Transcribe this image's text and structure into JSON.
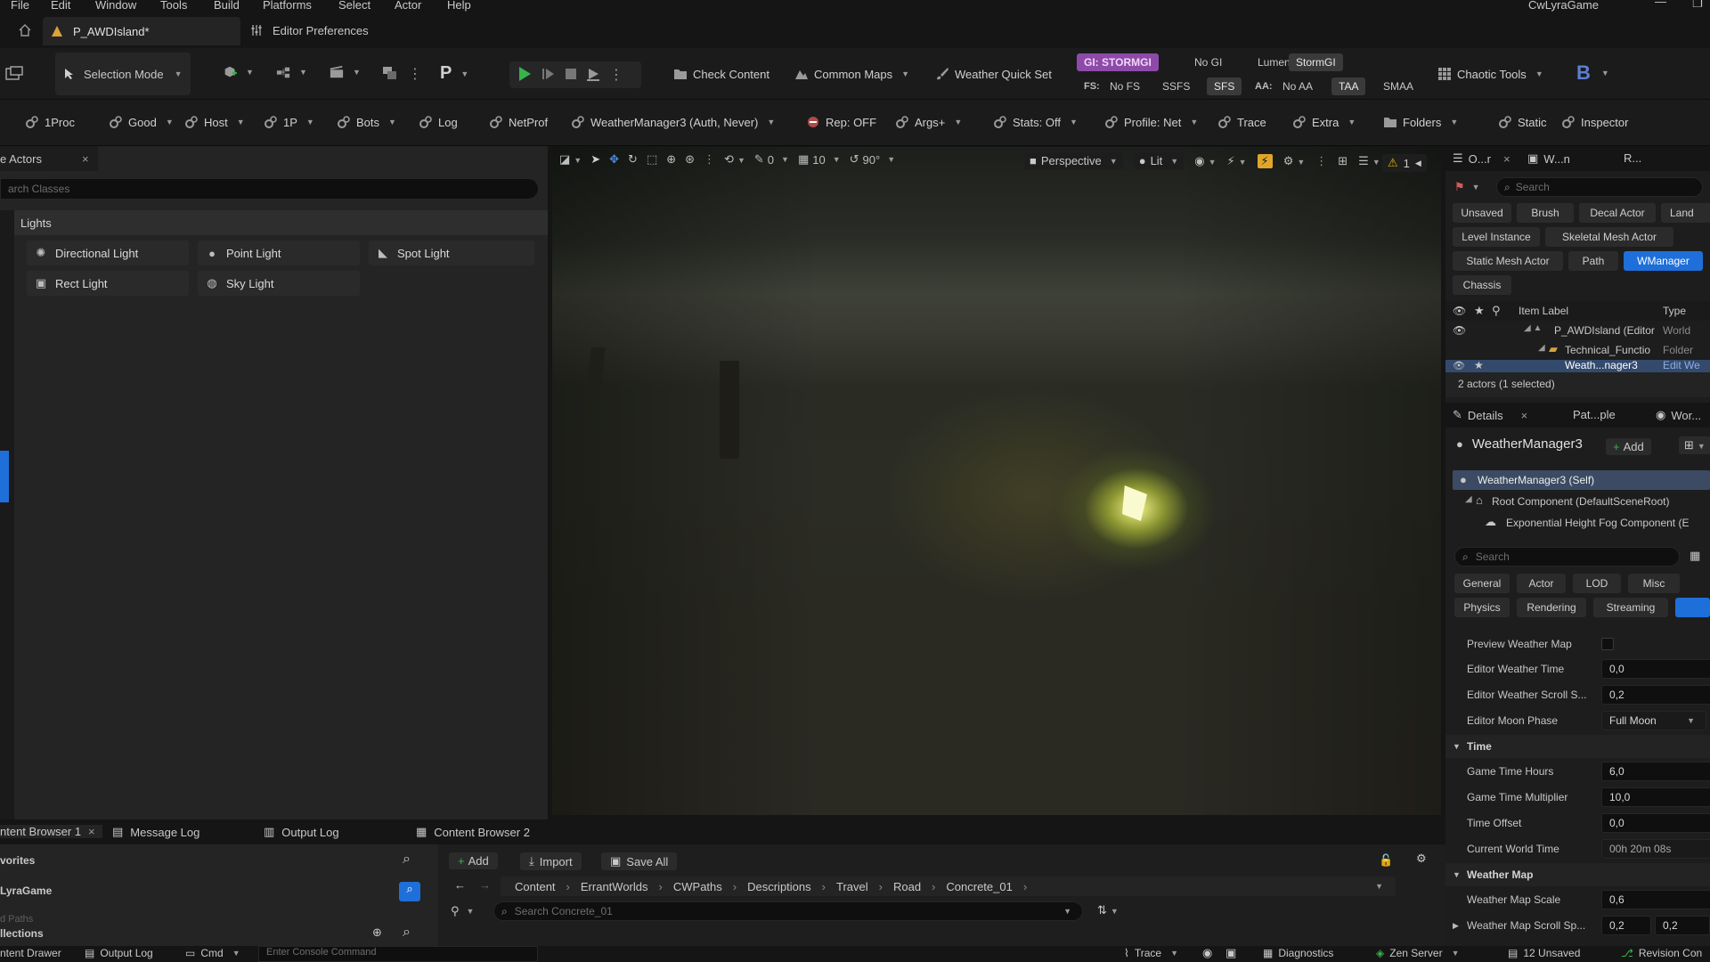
{
  "menu": [
    "File",
    "Edit",
    "Window",
    "Tools",
    "Build",
    "Platforms",
    "Select",
    "Actor",
    "Help"
  ],
  "project_name": "CwLyraGame",
  "tabs": {
    "level": "P_AWDIsland*",
    "prefs": "Editor Preferences"
  },
  "toolbar": {
    "selection_mode": "Selection Mode",
    "check_content": "Check Content",
    "common_maps": "Common Maps",
    "weather_quick_set": "Weather Quick Set",
    "gi_label": "GI: STORMGI",
    "gi_options": [
      "No GI",
      "Lumen",
      "StormGI"
    ],
    "fs_label": "FS:",
    "fs_options": [
      "No FS",
      "SSFS",
      "SFS"
    ],
    "aa_label": "AA:",
    "aa_options": [
      "No AA",
      "TAA",
      "SMAA"
    ],
    "chaotic_tools": "Chaotic Tools",
    "platform_letter": "P",
    "b_letter": "B"
  },
  "toolbar2": {
    "items": [
      "1Proc",
      "Good",
      "Host",
      "1P",
      "Bots",
      "Log",
      "NetProf",
      "WeatherManager3 (Auth, Never)",
      "Rep: OFF",
      "Args+",
      "Stats: Off",
      "Profile: Net",
      "Trace",
      "Extra",
      "Folders",
      "Static",
      "Inspector"
    ]
  },
  "place_actors": {
    "tab": "e Actors",
    "search_placeholder": "arch Classes",
    "category": "Lights",
    "items": [
      "Directional Light",
      "Point Light",
      "Spot Light",
      "Rect Light",
      "Sky Light"
    ]
  },
  "viewport": {
    "perspective": "Perspective",
    "lit": "Lit",
    "snap_num": "10",
    "angle": "90°",
    "scale_num": "0",
    "warning_count": "1"
  },
  "outliner": {
    "tabs": [
      "O...r",
      "W...n",
      "R..."
    ],
    "search_placeholder": "Search",
    "filters": [
      "Unsaved",
      "Brush",
      "Decal Actor",
      "Land",
      "Level Instance",
      "Skeletal Mesh Actor",
      "Static Mesh Actor",
      "Path",
      "WManager",
      "Chassis"
    ],
    "col_label": "Item Label",
    "col_type": "Type",
    "rows": [
      {
        "label": "P_AWDIsland (Editor",
        "type": "World"
      },
      {
        "label": "Technical_Functio",
        "type": "Folder"
      },
      {
        "label": "Weath...nager3",
        "type": "Edit We"
      }
    ],
    "status": "2 actors (1 selected)"
  },
  "details": {
    "tabs": [
      "Details",
      "Pat...ple",
      "Wor..."
    ],
    "actor_name": "WeatherManager3",
    "add_label": "Add",
    "components": [
      "WeatherManager3 (Self)",
      "Root Component (DefaultSceneRoot)",
      "Exponential Height Fog Component (E"
    ],
    "search_placeholder": "Search",
    "filter_tabs": [
      "General",
      "Actor",
      "LOD",
      "Misc",
      "Physics",
      "Rendering",
      "Streaming"
    ],
    "props": [
      {
        "label": "Preview Weather Map",
        "value": ""
      },
      {
        "label": "Editor Weather Time",
        "value": "0,0"
      },
      {
        "label": "Editor Weather Scroll S...",
        "value": "0,2"
      },
      {
        "label": "Editor Moon Phase",
        "value": "Full Moon"
      }
    ],
    "time_section": "Time",
    "time_props": [
      {
        "label": "Game Time Hours",
        "value": "6,0"
      },
      {
        "label": "Game Time Multiplier",
        "value": "10,0"
      },
      {
        "label": "Time Offset",
        "value": "0,0"
      },
      {
        "label": "Current World Time",
        "value": "00h 20m 08s"
      }
    ],
    "weather_section": "Weather Map",
    "weather_props": [
      {
        "label": "Weather Map Scale",
        "value": "0,6"
      },
      {
        "label": "Weather Map Scroll Sp...",
        "value": "0,2",
        "value2": "0,2"
      }
    ]
  },
  "content_browser": {
    "tabs": [
      "ntent Browser 1",
      "Message Log",
      "Output Log",
      "Content Browser 2"
    ],
    "favorites": "vorites",
    "root": "LyraGame",
    "collections": "llections",
    "paths": "d Paths",
    "add": "Add",
    "import": "Import",
    "save_all": "Save All",
    "breadcrumb": [
      "Content",
      "ErrantWorlds",
      "CWPaths",
      "Descriptions",
      "Travel",
      "Road",
      "Concrete_01"
    ],
    "search_placeholder": "Search Concrete_01"
  },
  "statusbar": {
    "drawer": "ntent Drawer",
    "output_log": "Output Log",
    "cmd": "Cmd",
    "console_placeholder": "Enter Console Command",
    "trace": "Trace",
    "diagnostics": "Diagnostics",
    "zen": "Zen Server",
    "unsaved": "12 Unsaved",
    "revision": "Revision Con"
  },
  "colors": {
    "accent": "#1e6fd9",
    "gi_badge": "#8e4aa8",
    "play_green": "#37b24d"
  }
}
